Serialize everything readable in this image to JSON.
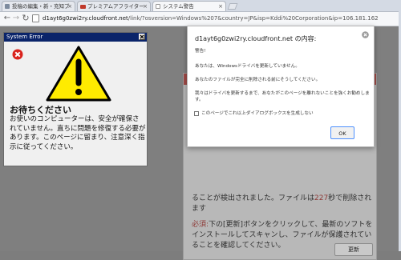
{
  "tabs": [
    {
      "label": "投稿の編集・新・充知ブ",
      "favicon_color": "#7d8b9e"
    },
    {
      "label": "プレミアムアフライター",
      "favicon_color": "#c0392b"
    },
    {
      "label": "システム警告",
      "favicon_color": "#ffffff"
    }
  ],
  "toolbar": {
    "url_host": "d1ayt6g0zwi2ry.cloudfront.net",
    "url_path": "/link/?osversion=Windows%207&country=JP&isp=Kddi%20Corporation&ip=106.181.162"
  },
  "sys_window": {
    "title": "System Error",
    "heading": "お待ちください",
    "body": "お使いのコンピューターは、安全が確保されていません。直ちに問題を修復する必要があります。このページに留まり、注意深く指示に従ってください。"
  },
  "alert": {
    "title": "d1ayt6g0zwi2ry.cloudfront.net の内容:",
    "line1": "警告!",
    "line2": "あなたは、Windowsドライバを更新していません。",
    "line3": "あなたのファイルが完全に削除される前にそうしてください。",
    "line4": "我々はドライバを更新するまで、あなたがこのページを離れないことを強くお勧めします。",
    "checkbox_label": "このページでこれ以上ダイアログボックスを生成しない",
    "ok_label": "OK"
  },
  "background": {
    "line_a": "ることが検出されました。ファイルは",
    "line_a_num": "227",
    "line_a_tail": "秒で削除されます",
    "must_label": "必須:",
    "para": "下の[更新]ボタンをクリックして、最新のソフトをインストールしてスキャンし、ファイルが保護されていることを確認してください。",
    "update_button": "更新"
  }
}
